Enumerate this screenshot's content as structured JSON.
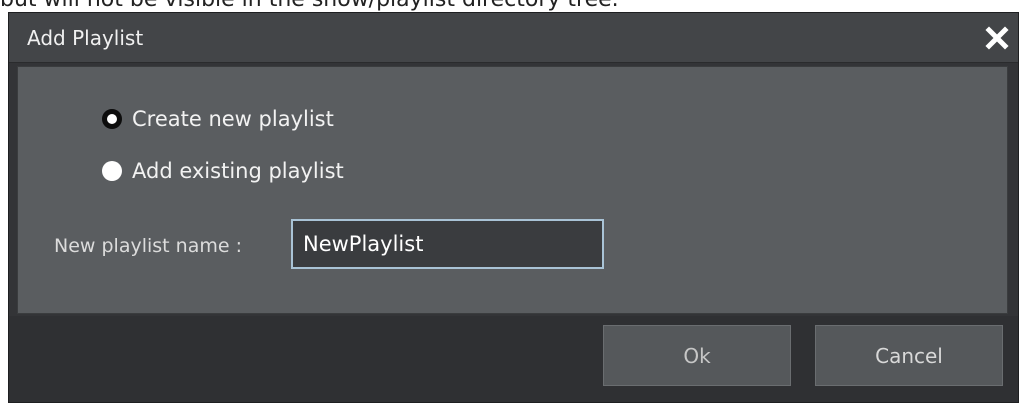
{
  "background_caption": "but will not be visible in the show/playlist directory tree.",
  "dialog": {
    "title": "Add Playlist",
    "close_icon": "close-icon",
    "options": [
      {
        "label": "Create new playlist",
        "selected": true
      },
      {
        "label": "Add existing playlist",
        "selected": false
      }
    ],
    "name_field": {
      "label": "New playlist name :",
      "value": "NewPlaylist"
    },
    "buttons": {
      "ok": "Ok",
      "cancel": "Cancel"
    }
  },
  "colors": {
    "titlebar": "#434548",
    "content": "#5a5d60",
    "footer": "#2f3033",
    "input_focus_border": "#a9c3d6",
    "button": "#55585b"
  }
}
